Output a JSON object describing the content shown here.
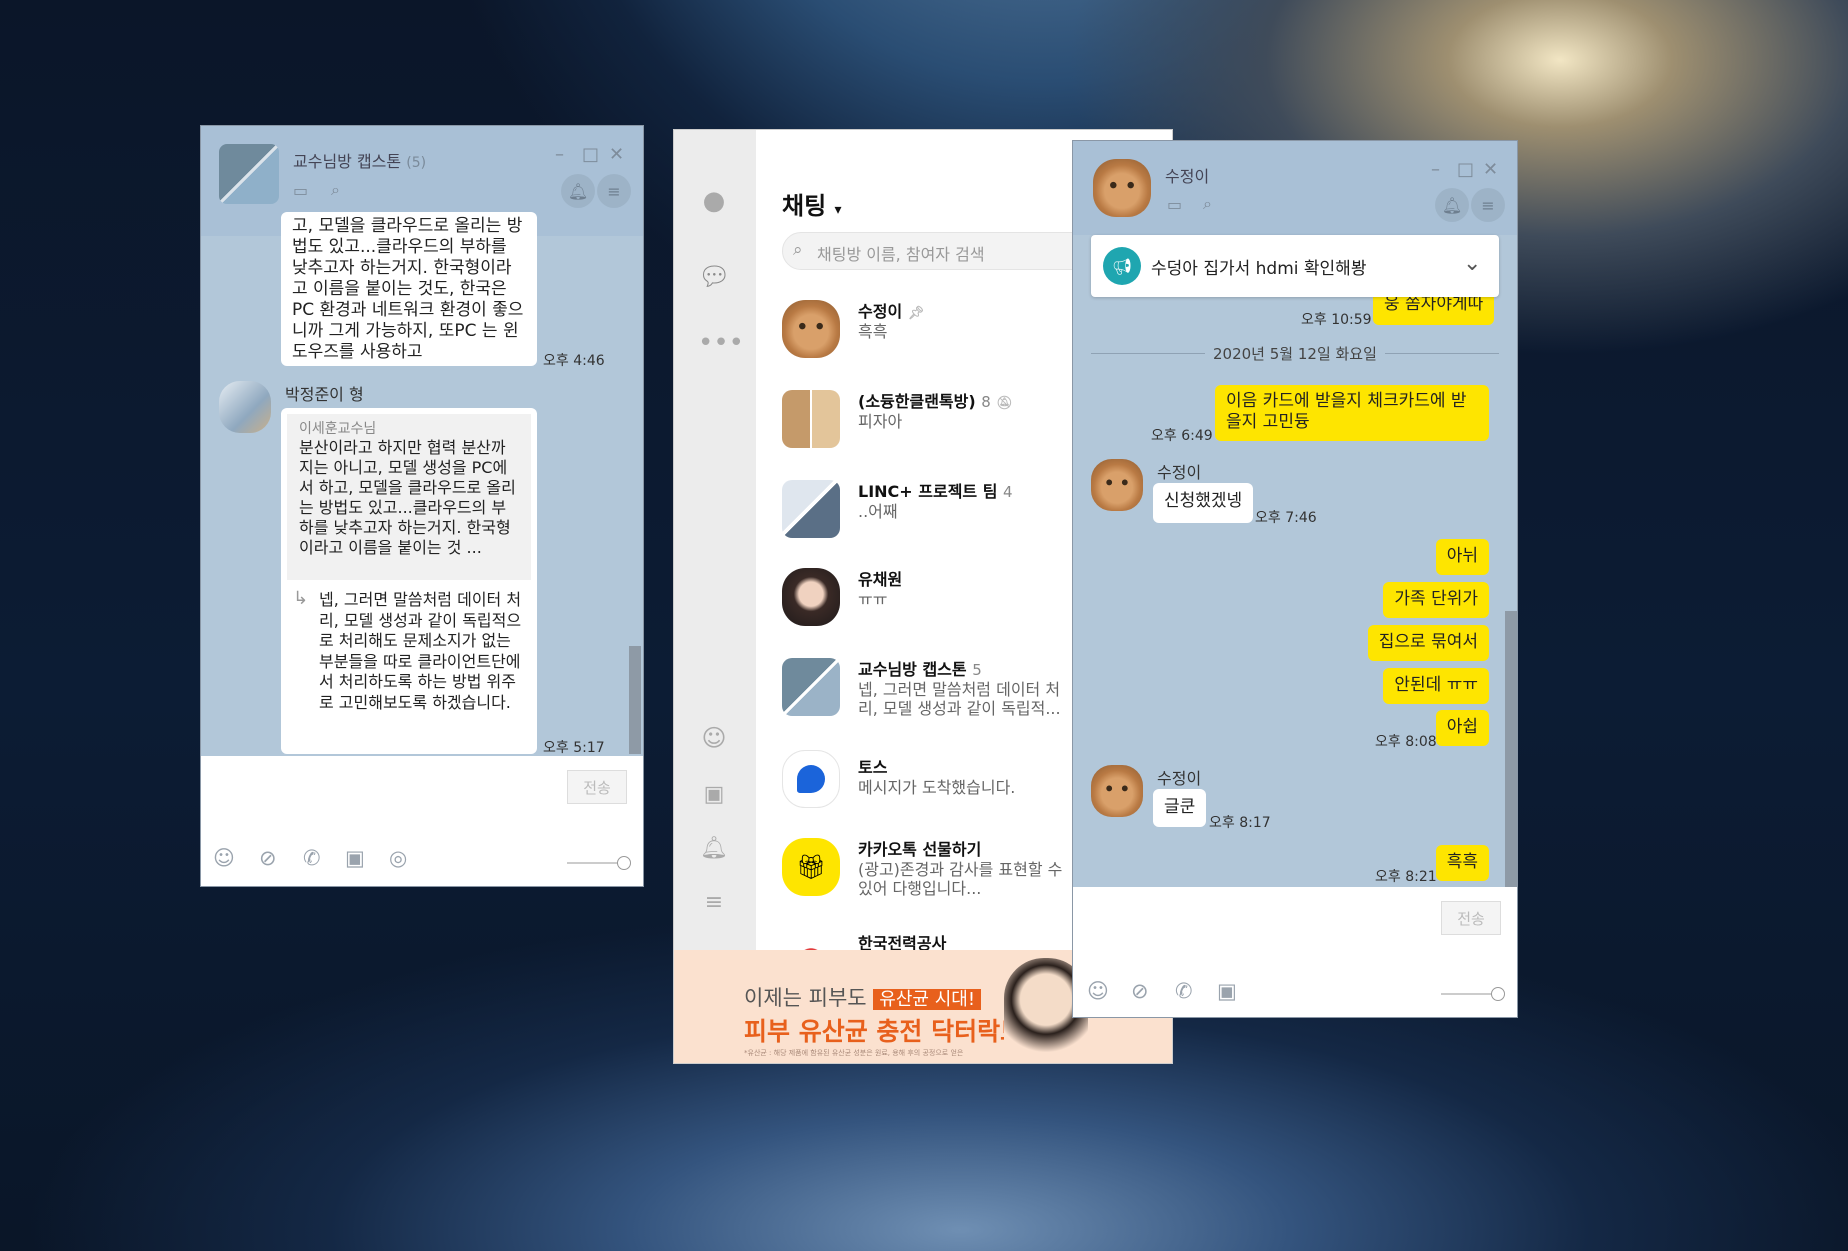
{
  "left_window": {
    "title": "교수님방 캡스톤",
    "member_count": "(5)",
    "message1_text": "고, 모델을 클라우드로 올리는 방법도 있고...클라우드의 부하를 낮추고자 하는거지. 한국형이라고 이름을 붙이는 것도, 한국은 PC 환경과 네트워크 환경이 좋으니까 그게 가능하지, 또PC 는 윈도우즈를 사용하고",
    "message1_time": "오후 4:46",
    "sender2": "박정준이 형",
    "quote_author": "이세훈교수님",
    "quote_text": "분산이라고 하지만 협력 분산까지는 아니고, 모델 생성을 PC에서 하고, 모델을 클라우드로 올리는 방법도 있고...클라우드의 부하를 낮추고자 하는거지. 한국형이라고 이름을 붙이는 것 ...",
    "reply_arrow": "↳",
    "reply_text": "넵, 그러면 말씀처럼 데이터 처리, 모델 생성과 같이 독립적으로 처리해도 문제소지가 없는 부분들을 따로 클라이언트단에서 처리하도록 하는 방법 위주로 고민해보도록 하겠습니다.",
    "message2_time": "오후 5:17",
    "send_label": "전송"
  },
  "main_window": {
    "title": "채팅",
    "title_caret": "▾",
    "search_placeholder": "채팅방 이름, 참여자 검색",
    "chats": [
      {
        "name": "수정이",
        "preview": "흑흑",
        "count": ""
      },
      {
        "name": "(소듕한클랜톡방)",
        "preview": "피자아",
        "count": "8"
      },
      {
        "name": "LINC+ 프로젝트 팀",
        "preview": "..어째",
        "count": "4"
      },
      {
        "name": "유채원",
        "preview": "ㅠㅠ",
        "count": ""
      },
      {
        "name": "교수님방 캡스톤",
        "preview": "넵, 그러면 말씀처럼 데이터 처리, 모델 생성과 같이 독립적...",
        "count": "5"
      },
      {
        "name": "토스",
        "preview": "메시지가 도착했습니다.",
        "count": ""
      },
      {
        "name": "카카오톡 선물하기",
        "preview": "(광고)존경과 감사를 표현할 수 있어 다행입니다...",
        "count": ""
      },
      {
        "name": "한국전력공사",
        "preview": "",
        "count": ""
      }
    ],
    "ad": {
      "line1_a": "이제는 피부도",
      "line1_b": "유산균 시대!",
      "line2": "피부 유산균 충전 닥터락토",
      "fine_print": "*유산균 : 해당 제품에 함유된 유산균 성분은 원료, 용해 후의 공정으로 얻은"
    }
  },
  "right_window": {
    "title": "수정이",
    "notice": "수덩아 집가서 hdmi 확인해봥",
    "msg_top_text": "웅 쫌자야게따",
    "msg_top_time": "오후 10:59",
    "date_divider": "2020년 5월 12일 화요일",
    "msg_card_text": "이음 카드에 받을지 체크카드에 받을지 고민듕",
    "msg_card_time": "오후 6:49",
    "sender": "수정이",
    "msg_apply_text": "신청했겠넹",
    "msg_apply_time": "오후 7:46",
    "my_msgs": [
      "아뉘",
      "가족 단위가",
      "집으로 묶여서",
      "안된데 ㅠㅠ",
      "아쉽"
    ],
    "my_msgs_time": "오후 8:08",
    "msg_gul_text": "글쿤",
    "msg_gul_time": "오후 8:17",
    "msg_last_text": "흑흑",
    "msg_last_time": "오후 8:21",
    "send_label": "전송"
  },
  "colors": {
    "chat_bg": "#b2c7d9",
    "kakao_yellow": "#fee500",
    "ad_bg": "#fbe1cf",
    "ad_orange": "#e8601c"
  }
}
